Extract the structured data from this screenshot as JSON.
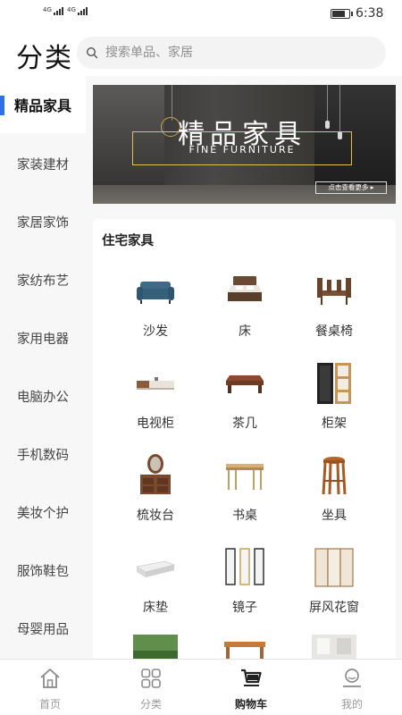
{
  "status_bar": {
    "signal_1": "4G",
    "signal_2": "4G",
    "battery_level": 0.75,
    "time": "6:38"
  },
  "header": {
    "title": "分类",
    "search_placeholder": "搜索单品、家居"
  },
  "sidebar": {
    "items": [
      {
        "label": "精品家具",
        "active": true
      },
      {
        "label": "家装建材",
        "active": false
      },
      {
        "label": "家居家饰",
        "active": false
      },
      {
        "label": "家纺布艺",
        "active": false
      },
      {
        "label": "家用电器",
        "active": false
      },
      {
        "label": "电脑办公",
        "active": false
      },
      {
        "label": "手机数码",
        "active": false
      },
      {
        "label": "美妆个护",
        "active": false
      },
      {
        "label": "服饰鞋包",
        "active": false
      },
      {
        "label": "母婴用品",
        "active": false
      }
    ]
  },
  "banner": {
    "title": "精品家具",
    "subtitle": "FINE FURNITURE",
    "more": "点击查看更多 ▸"
  },
  "section": {
    "title": "住宅家具",
    "items": [
      {
        "label": "沙发",
        "icon": "sofa-icon"
      },
      {
        "label": "床",
        "icon": "bed-icon"
      },
      {
        "label": "餐桌椅",
        "icon": "dining-set-icon"
      },
      {
        "label": "电视柜",
        "icon": "tv-cabinet-icon"
      },
      {
        "label": "茶几",
        "icon": "coffee-table-icon"
      },
      {
        "label": "柜架",
        "icon": "shelf-icon"
      },
      {
        "label": "梳妆台",
        "icon": "dresser-icon"
      },
      {
        "label": "书桌",
        "icon": "desk-icon"
      },
      {
        "label": "坐具",
        "icon": "stool-icon"
      },
      {
        "label": "床垫",
        "icon": "mattress-icon"
      },
      {
        "label": "镜子",
        "icon": "mirror-icon"
      },
      {
        "label": "屏风花窗",
        "icon": "screen-icon"
      },
      {
        "label": "",
        "icon": "outdoor-furniture-icon"
      },
      {
        "label": "",
        "icon": "bench-icon"
      },
      {
        "label": "",
        "icon": "room-icon"
      }
    ]
  },
  "tabbar": {
    "tabs": [
      {
        "label": "首页",
        "icon": "home-icon",
        "active": false
      },
      {
        "label": "分类",
        "icon": "category-icon",
        "active": false
      },
      {
        "label": "购物车",
        "icon": "cart-icon",
        "active": true
      },
      {
        "label": "我的",
        "icon": "profile-icon",
        "active": false
      }
    ]
  },
  "colors": {
    "accent": "#2b72e8",
    "banner_frame": "#e3c14e",
    "sidebar_bg": "#f7f7f7",
    "tab_inactive": "#9a9a9a",
    "tab_active": "#222222"
  }
}
